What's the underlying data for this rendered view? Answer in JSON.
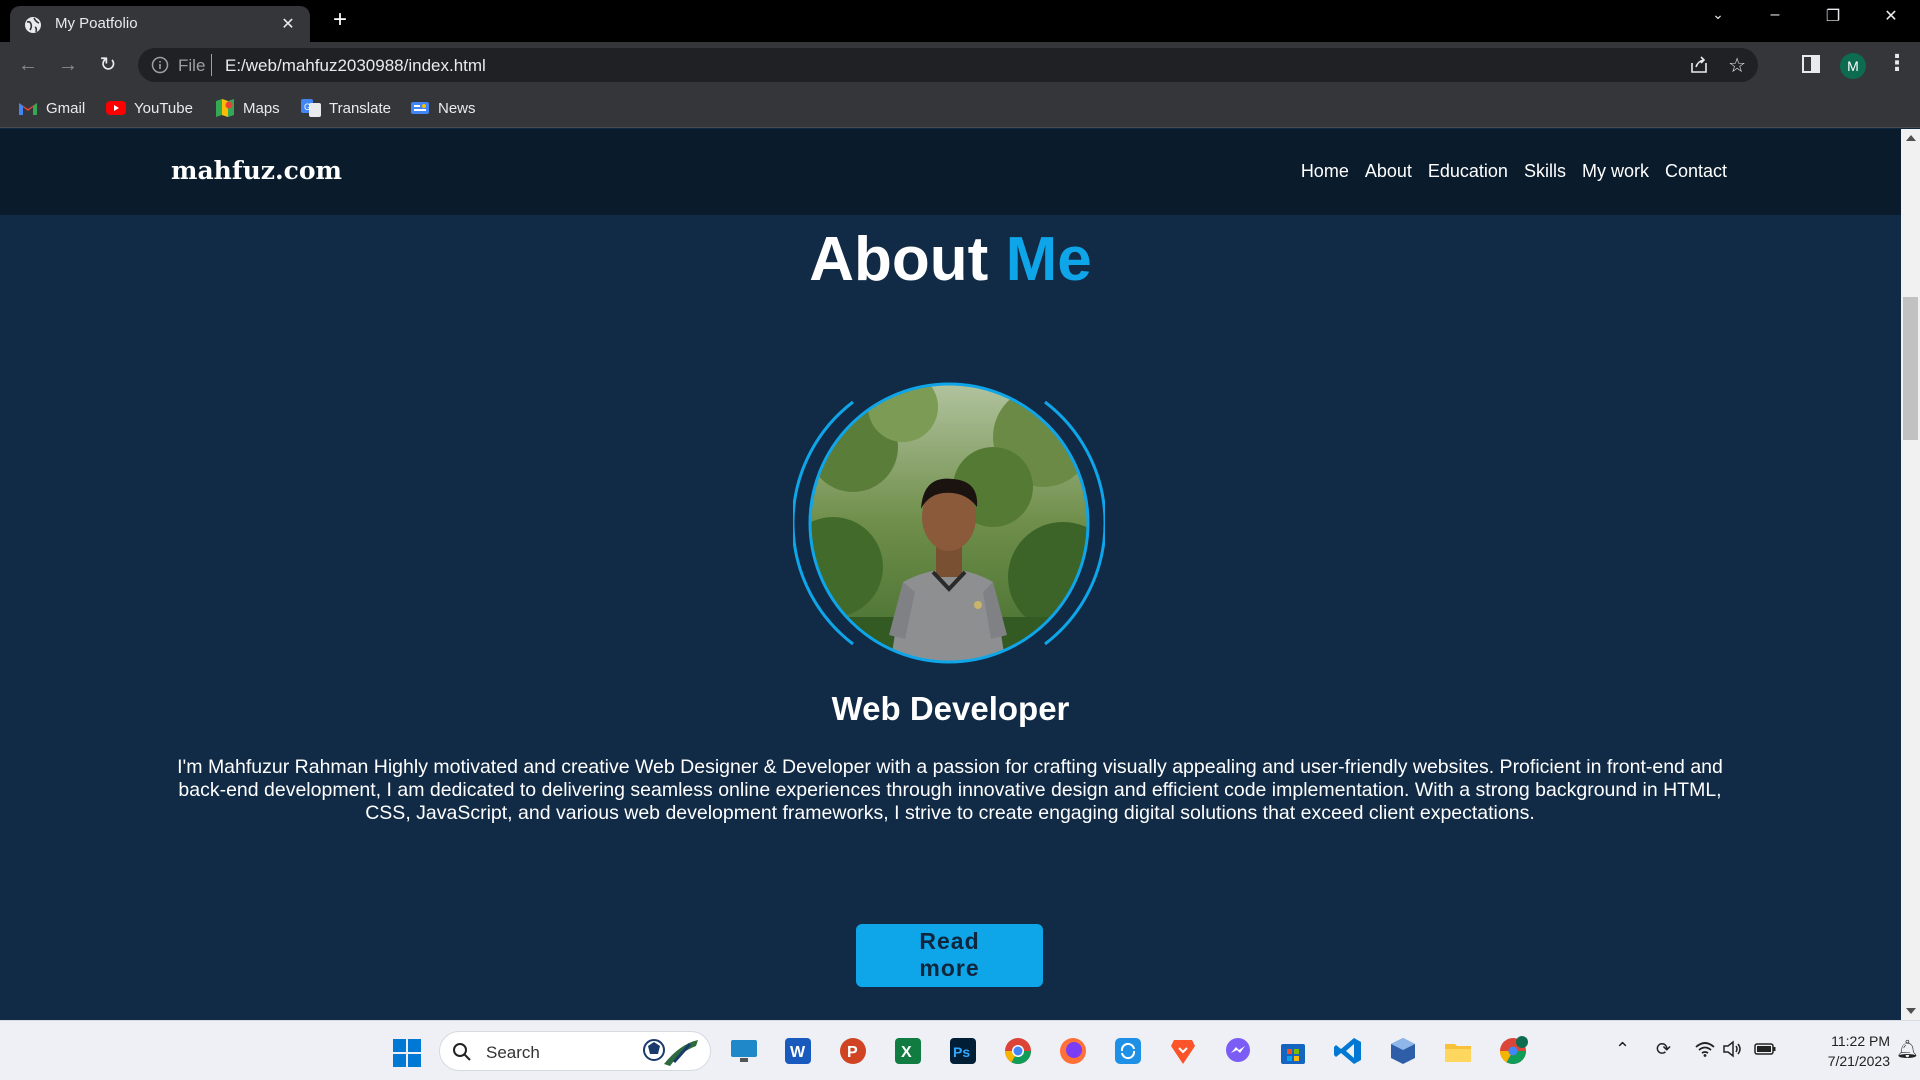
{
  "browser": {
    "tab_title": "My Poatfolio",
    "tab_close": "✕",
    "new_tab": "+",
    "url_scheme": "File",
    "url": "E:/web/mahfuz2030988/index.html",
    "profile_initial": "M",
    "bookmarks": [
      {
        "label": "Gmail",
        "icon": "gmail-icon"
      },
      {
        "label": "YouTube",
        "icon": "youtube-icon"
      },
      {
        "label": "Maps",
        "icon": "maps-icon"
      },
      {
        "label": "Translate",
        "icon": "translate-icon"
      },
      {
        "label": "News",
        "icon": "news-icon"
      }
    ]
  },
  "site": {
    "logo": "mahfuz.com",
    "nav": [
      "Home",
      "About",
      "Education",
      "Skills",
      "My work",
      "Contact"
    ],
    "section_title_main": "About",
    "section_title_accent": "Me",
    "role": "Web Developer",
    "bio": "I'm Mahfuzur Rahman Highly motivated and creative Web Designer & Developer with a passion for crafting visually appealing and user-friendly websites. Proficient in front-end and back-end development, I am dedicated to delivering seamless online experiences through innovative design and efficient code implementation. With a strong background in HTML, CSS, JavaScript, and various web development frameworks, I strive to create engaging digital solutions that exceed client expectations.",
    "read_more_line1": "Read",
    "read_more_line2": "more",
    "colors": {
      "accent": "#0ea5e9",
      "background": "#112a45",
      "navbar": "#0a1b2c"
    }
  },
  "taskbar": {
    "search_placeholder": "Search",
    "time": "11:22 PM",
    "date": "7/21/2023",
    "apps": [
      "desktop-icon",
      "word-icon",
      "powerpoint-icon",
      "excel-icon",
      "photoshop-icon",
      "chrome-icon",
      "firefox-icon",
      "sync-icon",
      "brave-icon",
      "messenger-icon",
      "store-icon",
      "vscode-icon",
      "virtualbox-icon",
      "file-explorer-icon",
      "chrome-profile-icon"
    ]
  }
}
